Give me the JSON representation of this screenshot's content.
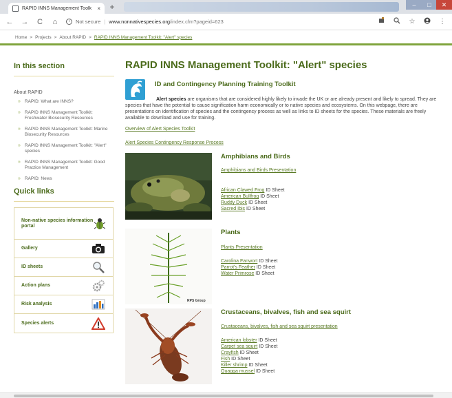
{
  "browser": {
    "tab_title": "RAPID INNS Management Toolk",
    "url_security": "Not secure",
    "url_host": "www.nonnativespecies.org",
    "url_path": "/index.cfm?pageid=623"
  },
  "breadcrumb": {
    "items": [
      "Home",
      "Projects",
      "About RAPID"
    ],
    "separator": ">",
    "current": "RAPID INNS Management Toolkit: \"Alert\" species"
  },
  "sidebar": {
    "heading": "In this section",
    "about_label": "About RAPID",
    "items": [
      "RAPID: What are INNS?",
      "RAPID INNS Management Toolkit: Freshwater Biosecurity Resources",
      "RAPID INNS Management Toolkit: Marine Biosecurity Resources",
      "RAPID INNS Management Toolkit: \"Alert\" species",
      "RAPID INNS Management Toolkit: Good Practice Management",
      "RAPID: News"
    ],
    "quick_links_heading": "Quick links",
    "quick_links": [
      {
        "label": "Non-native species information portal",
        "icon": "beetle-icon"
      },
      {
        "label": "Gallery",
        "icon": "camera-icon"
      },
      {
        "label": "ID sheets",
        "icon": "magnifier-icon"
      },
      {
        "label": "Action plans",
        "icon": "gears-icon"
      },
      {
        "label": "Risk analysis",
        "icon": "bar-chart-icon"
      },
      {
        "label": "Species alerts",
        "icon": "warning-icon"
      }
    ]
  },
  "main": {
    "title": "RAPID INNS Management Toolkit: \"Alert\" species",
    "toolkit_heading": "ID and Contingency Planning Training Toolkit",
    "intro_bold": "Alert species",
    "intro_text": " are organisms that are considered highly likely to invade the UK or are already present and likely to spread. They are species that have the potential to cause signification harm economically or to native species and ecosystems.  On this webpage, there are presentations on identification of species and the contingency process as well as links to ID sheets for the species. These materials are freely available to download and use for training.",
    "link_overview": "Overview of Alert Species Toolkit",
    "link_contingency": "Alert Species Contingency Response Process",
    "id_sheet_suffix": " ID Sheet",
    "sections": [
      {
        "heading": "Amphibians and Birds",
        "presentation": "Amphibians and Birds Presentation",
        "species": [
          "African Clawed Frog",
          "American Bullfrog",
          "Ruddy Duck",
          "Sacred Ibis"
        ]
      },
      {
        "heading": "Plants",
        "presentation": "Plants Presentation",
        "photo_credit": "RPS Group",
        "species": [
          "Carolina Fanwort",
          "Parrot's Feather",
          "Water Primrose"
        ]
      },
      {
        "heading": "Crustaceans, bivalves, fish and sea squirt",
        "presentation": "Crustaceans, bivalves, fish and sea squirt presentation",
        "species": [
          "American lobster",
          "Carpet sea squirt",
          "Crayfish",
          "Fish",
          "Killer shrimp",
          "Quagga mussel"
        ]
      }
    ]
  }
}
